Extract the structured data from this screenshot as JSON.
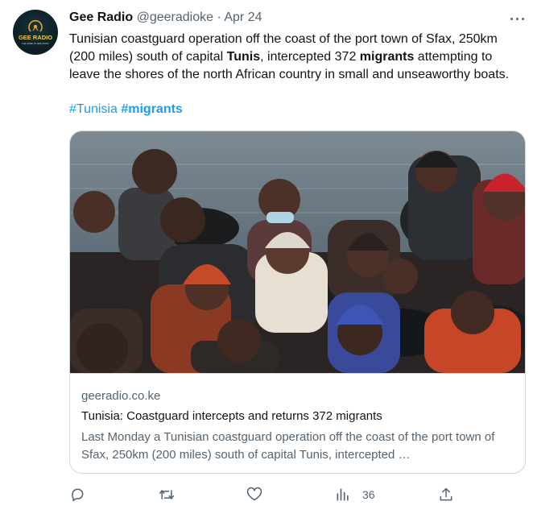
{
  "author": {
    "avatar_text": "GEE RADIO",
    "avatar_subtext": "THE HOME OF NEW MUSIC",
    "display_name": "Gee Radio",
    "handle": "@geeradioke",
    "separator": "·",
    "date": "Apr 24"
  },
  "tweet": {
    "text_part1": "Tunisian coastguard operation off the coast of the port town of Sfax, 250km (200 miles) south of capital ",
    "text_bold1": "Tunis",
    "text_part2": ", intercepted 372 ",
    "text_bold2": "migrants",
    "text_part3": " attempting to leave the shores of the north African country in small and unseaworthy boats.",
    "hashtag1": "#Tunisia",
    "hashtag2": "#migrants"
  },
  "card": {
    "image_description_icon": "photo-migrants-in-boat",
    "domain": "geeradio.co.ke",
    "title": "Tunisia: Coastguard intercepts and returns 372 migrants",
    "description": "Last Monday a Tunisian coastguard operation off the coast of the port town of Sfax, 250km (200 miles) south of capital Tunis, intercepted …"
  },
  "actions": {
    "reply_icon": "reply-icon",
    "retweet_icon": "retweet-icon",
    "like_icon": "heart-icon",
    "views_icon": "views-icon",
    "views_count": "36",
    "share_icon": "share-icon"
  },
  "colors": {
    "link": "#1d9bf0",
    "secondary_text": "#536471",
    "border": "#cfd9de"
  }
}
